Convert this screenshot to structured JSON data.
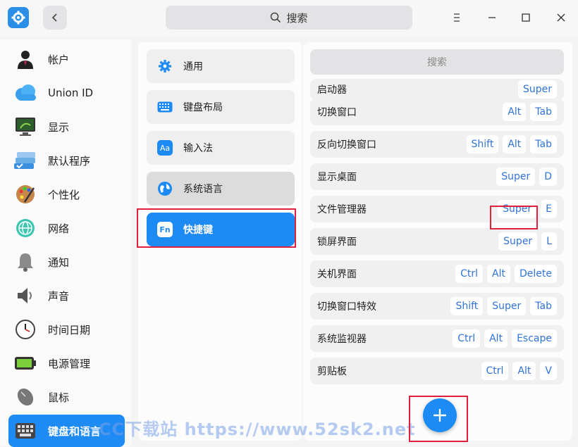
{
  "titlebar": {
    "search_text": "搜索"
  },
  "sidebar": {
    "items": [
      {
        "label": "帐户",
        "icon": "user-icon"
      },
      {
        "label": "Union ID",
        "icon": "cloud-icon"
      },
      {
        "label": "显示",
        "icon": "monitor-icon"
      },
      {
        "label": "默认程序",
        "icon": "default-apps-icon"
      },
      {
        "label": "个性化",
        "icon": "palette-icon"
      },
      {
        "label": "网络",
        "icon": "network-icon"
      },
      {
        "label": "通知",
        "icon": "bell-icon"
      },
      {
        "label": "声音",
        "icon": "speaker-icon"
      },
      {
        "label": "时间日期",
        "icon": "clock-icon"
      },
      {
        "label": "电源管理",
        "icon": "battery-icon"
      },
      {
        "label": "鼠标",
        "icon": "mouse-icon"
      },
      {
        "label": "键盘和语言",
        "icon": "keyboard-icon",
        "active": true
      }
    ]
  },
  "middle": {
    "items": [
      {
        "label": "通用",
        "icon": "gear-icon"
      },
      {
        "label": "键盘布局",
        "icon": "keyboard-layout-icon"
      },
      {
        "label": "输入法",
        "icon": "input-method-icon",
        "icon_text": "Aa"
      },
      {
        "label": "系统语言",
        "icon": "globe-icon"
      },
      {
        "label": "快捷键",
        "icon": "fn-icon",
        "icon_text": "Fn",
        "active": true
      }
    ]
  },
  "right": {
    "search_placeholder": "搜索",
    "shortcuts": [
      {
        "name": "启动器",
        "keys": [
          "Super"
        ]
      },
      {
        "name": "切换窗口",
        "keys": [
          "Alt",
          "Tab"
        ]
      },
      {
        "name": "反向切换窗口",
        "keys": [
          "Shift",
          "Alt",
          "Tab"
        ]
      },
      {
        "name": "显示桌面",
        "keys": [
          "Super",
          "D"
        ]
      },
      {
        "name": "文件管理器",
        "keys": [
          "Super",
          "E"
        ]
      },
      {
        "name": "锁屏界面",
        "keys": [
          "Super",
          "L"
        ]
      },
      {
        "name": "关机界面",
        "keys": [
          "Ctrl",
          "Alt",
          "Delete"
        ]
      },
      {
        "name": "切换窗口特效",
        "keys": [
          "Shift",
          "Super",
          "Tab"
        ]
      },
      {
        "name": "系统监视器",
        "keys": [
          "Ctrl",
          "Alt",
          "Escape"
        ]
      },
      {
        "name": "剪贴板",
        "keys": [
          "Ctrl",
          "Alt",
          "V"
        ]
      }
    ]
  },
  "watermark": "CC下载站 https://www.52sk2.net",
  "colors": {
    "accent": "#1e8bf5",
    "highlight": "#e2203d",
    "key_text": "#2f73d9"
  }
}
